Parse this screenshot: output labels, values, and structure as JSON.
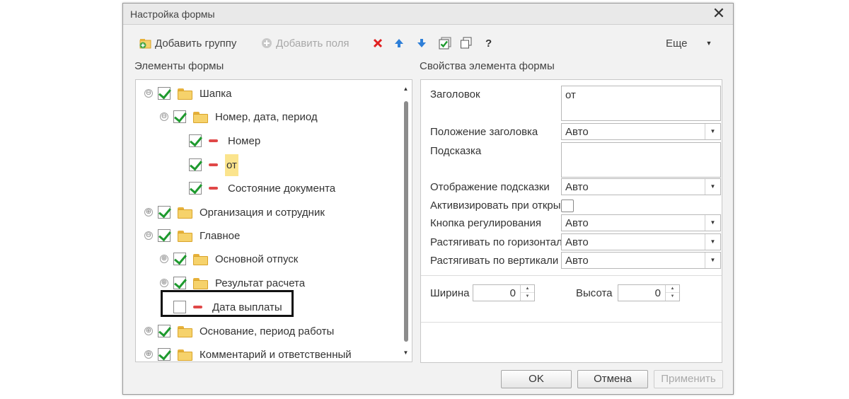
{
  "window": {
    "title": "Настройка формы",
    "close_symbol": "✕"
  },
  "toolbar": {
    "add_group": "Добавить группу",
    "add_fields": "Добавить поля",
    "help": "?",
    "more": "Еще",
    "more_arrow": "▼"
  },
  "left_panel": {
    "title": "Элементы формы",
    "items": [
      {
        "label": "Шапка",
        "expander": "⊖",
        "checked": true,
        "icon": "folder-icon",
        "level": 0
      },
      {
        "label": "Номер, дата, период",
        "expander": "⊖",
        "checked": true,
        "icon": "folder-icon",
        "level": 1
      },
      {
        "label": "Номер",
        "expander": "",
        "checked": true,
        "icon": "field-icon",
        "level": 2
      },
      {
        "label": "от",
        "expander": "",
        "checked": true,
        "icon": "field-icon",
        "level": 2,
        "selected": true
      },
      {
        "label": "Состояние документа",
        "expander": "",
        "checked": true,
        "icon": "field-icon",
        "level": 2
      },
      {
        "label": "Организация и сотрудник",
        "expander": "⊕",
        "checked": true,
        "icon": "folder-icon",
        "level": 0
      },
      {
        "label": "Главное",
        "expander": "⊖",
        "checked": true,
        "icon": "folder-icon",
        "level": 0
      },
      {
        "label": "Основной отпуск",
        "expander": "⊕",
        "checked": true,
        "icon": "folder-icon",
        "level": 1
      },
      {
        "label": "Результат расчета",
        "expander": "⊕",
        "checked": true,
        "icon": "folder-icon",
        "level": 1
      },
      {
        "label": "Дата выплаты",
        "expander": "",
        "checked": false,
        "icon": "field-icon",
        "level": 1
      },
      {
        "label": "Основание, период работы",
        "expander": "⊕",
        "checked": true,
        "icon": "folder-icon",
        "level": 0
      },
      {
        "label": "Комментарий и ответственный",
        "expander": "⊕",
        "checked": true,
        "icon": "folder-icon",
        "level": 0
      }
    ],
    "scroll_up": "▲",
    "scroll_down": "▼"
  },
  "right_panel": {
    "title": "Свойства элемента формы",
    "props": {
      "title_label": "Заголовок",
      "title_value": "от",
      "title_pos_label": "Положение заголовка",
      "title_pos_value": "Авто",
      "hint_label": "Подсказка",
      "hint_value": "",
      "hint_display_label": "Отображение подсказки",
      "hint_display_value": "Авто",
      "activate_label": "Активизировать при откры",
      "adjust_button_label": "Кнопка регулирования",
      "adjust_button_value": "Авто",
      "stretch_h_label": "Растягивать по горизонтал",
      "stretch_h_value": "Авто",
      "stretch_v_label": "Растягивать по вертикали",
      "stretch_v_value": "Авто",
      "width_label": "Ширина",
      "width_value": "0",
      "height_label": "Высота",
      "height_value": "0",
      "combo_arrow": "▼",
      "spin_up": "▲",
      "spin_down": "▼"
    }
  },
  "buttons": {
    "ok": "OK",
    "cancel": "Отмена",
    "apply": "Применить"
  },
  "colors": {
    "check": "#1e9a2e",
    "field_icon": "#e04848",
    "selection": "#fbe48d",
    "delete": "#e02020",
    "arrow": "#2e7fd8"
  }
}
